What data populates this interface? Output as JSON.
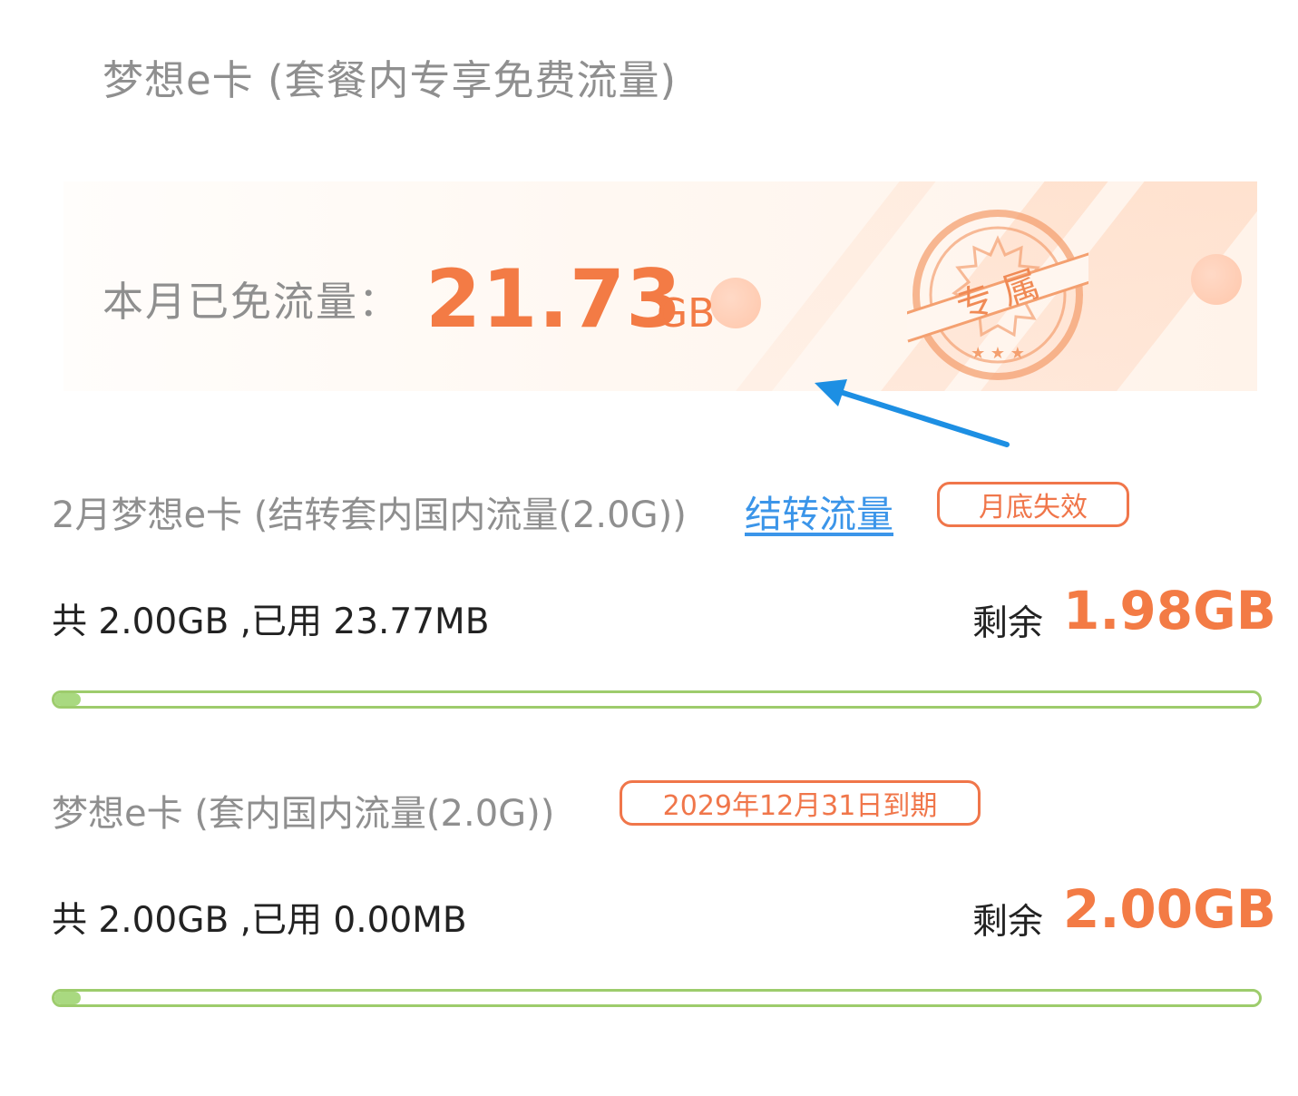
{
  "header": {
    "title": "梦想e卡 (套餐内专享免费流量)"
  },
  "banner": {
    "label": "本月已免流量：",
    "value": "21.73",
    "unit": "GB",
    "stamp_text": "专 属"
  },
  "plans": [
    {
      "title": "2月梦想e卡 (结转套内国内流量(2.0G))",
      "link": "结转流量",
      "badge": "月底失效",
      "usage": "共 2.00GB ,已用 23.77MB",
      "remain_label": "剩余",
      "remain_value": "1.98GB",
      "used_fraction": 0.012
    },
    {
      "title": "梦想e卡 (套内国内流量(2.0G))",
      "badge": "2029年12月31日到期",
      "usage": "共 2.00GB ,已用 0.00MB",
      "remain_label": "剩余",
      "remain_value": "2.00GB",
      "used_fraction": 0.0
    }
  ],
  "colors": {
    "accent": "#f37b45",
    "link": "#3b95e9",
    "progress_border": "#9dcc6c",
    "progress_fill": "#a9d980",
    "muted_text": "#8f8f8f",
    "annotation_arrow": "#1d8fe3"
  }
}
